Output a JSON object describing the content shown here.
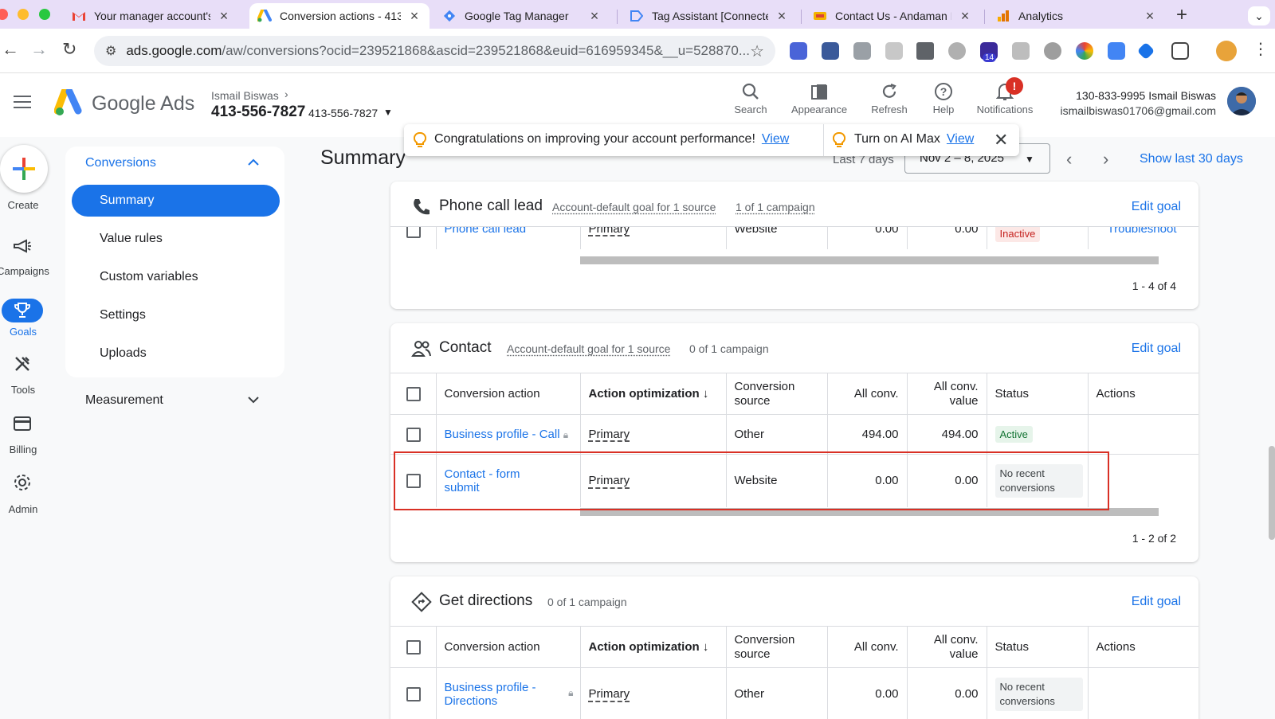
{
  "browser": {
    "tabs": [
      {
        "title": "Your manager account's",
        "icon": "gmail-icon",
        "active": false
      },
      {
        "title": "Conversion actions - 413",
        "icon": "google-ads-icon",
        "active": true
      },
      {
        "title": "Google Tag Manager",
        "icon": "tag-manager-icon",
        "active": false
      },
      {
        "title": "Tag Assistant [Connecte",
        "icon": "tag-assistant-icon",
        "active": false
      },
      {
        "title": "Contact Us - Andaman E",
        "icon": "site-icon",
        "active": false
      },
      {
        "title": "Analytics",
        "icon": "analytics-icon",
        "active": false
      }
    ],
    "url_host": "ads.google.com",
    "url_path": "/aw/conversions?ocid=239521868&ascid=239521868&euid=616959345&__u=528870...",
    "extension_badge": "14"
  },
  "header": {
    "brand": "Google Ads",
    "account_name": "Ismail Biswas",
    "account_id": "413-556-7827",
    "account_id_small": "413-556-7827",
    "actions": [
      {
        "label": "Search",
        "icon": "search-icon"
      },
      {
        "label": "Appearance",
        "icon": "appearance-icon"
      },
      {
        "label": "Refresh",
        "icon": "refresh-icon"
      },
      {
        "label": "Help",
        "icon": "help-icon"
      },
      {
        "label": "Notifications",
        "icon": "bell-icon"
      }
    ],
    "notification_badge": "!",
    "user_phone_name": "130-833-9995 Ismail Biswas",
    "user_email": "ismailbiswas01706@gmail.com"
  },
  "rail": {
    "items": [
      {
        "label": "Create",
        "icon": "plus-icon"
      },
      {
        "label": "Campaigns",
        "icon": "megaphone-icon"
      },
      {
        "label": "Goals",
        "icon": "trophy-icon"
      },
      {
        "label": "Tools",
        "icon": "tools-icon"
      },
      {
        "label": "Billing",
        "icon": "billing-icon"
      },
      {
        "label": "Admin",
        "icon": "gear-icon"
      }
    ]
  },
  "subnav": {
    "heading": "Conversions",
    "items": [
      "Summary",
      "Value rules",
      "Custom variables",
      "Settings",
      "Uploads"
    ],
    "measurement": "Measurement"
  },
  "main": {
    "title": "Summary",
    "date_label": "Last 7 days",
    "date_range": "Nov 2 – 8, 2025",
    "show_last": "Show last 30 days"
  },
  "toast": {
    "message1": "Congratulations on improving your account performance!",
    "link1": "View",
    "message2": "Turn on AI Max",
    "link2": "View"
  },
  "columns": {
    "action": "Conversion action",
    "optimization": "Action optimization",
    "source_line1": "Conversion",
    "source_line2": "source",
    "all_conv": "All conv.",
    "value_line1": "All conv.",
    "value_line2": "value",
    "status": "Status",
    "actions": "Actions"
  },
  "cards": {
    "phone": {
      "title": "Phone call lead",
      "meta1": "Account-default goal for 1 source",
      "meta2": "1 of 1 campaign",
      "edit": "Edit goal",
      "row": {
        "name": "Phone call lead",
        "optimization": "Primary",
        "source": "Website",
        "all_conv": "0.00",
        "value": "0.00",
        "status": "Inactive",
        "action": "Troubleshoot"
      },
      "pager": "1 - 4 of 4"
    },
    "contact": {
      "title": "Contact",
      "meta1": "Account-default goal for 1 source",
      "meta2": "0 of 1 campaign",
      "edit": "Edit goal",
      "rows": [
        {
          "name": "Business profile - Call",
          "optimization": "Primary",
          "source": "Other",
          "all_conv": "494.00",
          "value": "494.00",
          "status": "Active"
        },
        {
          "name_line1": "Contact - form",
          "name_line2": "submit",
          "optimization": "Primary",
          "source": "Website",
          "all_conv": "0.00",
          "value": "0.00",
          "status_line1": "No recent",
          "status_line2": "conversions"
        }
      ],
      "pager": "1 - 2 of 2"
    },
    "directions": {
      "title": "Get directions",
      "meta1": "0 of 1 campaign",
      "edit": "Edit goal",
      "row": {
        "name_line1": "Business profile -",
        "name_line2": "Directions",
        "optimization": "Primary",
        "source": "Other",
        "all_conv": "0.00",
        "value": "0.00",
        "status_line1": "No recent",
        "status_line2": "conversions"
      }
    }
  },
  "colors": {
    "accent": "#1a73e8",
    "highlight": "#d93025",
    "active_chip": "#e6f4ea"
  }
}
